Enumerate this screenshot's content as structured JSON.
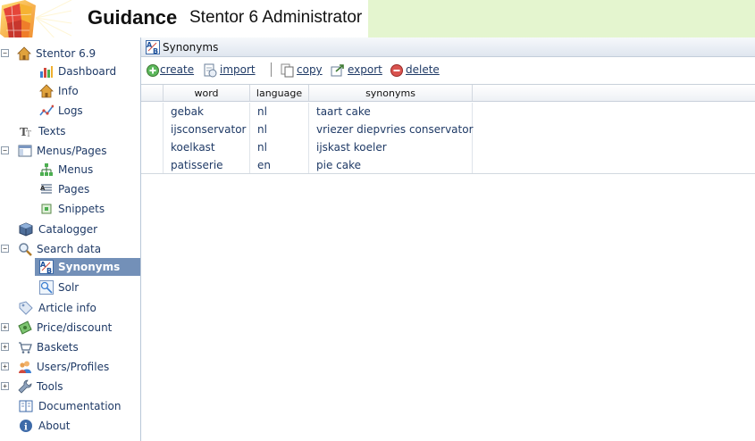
{
  "header": {
    "brand": "Guidance",
    "product": "Stentor 6 Administrator"
  },
  "sidebar": {
    "items": [
      {
        "label": "Stentor 6.9",
        "icon": "home-icon",
        "toggle": "−"
      },
      {
        "label": "Dashboard",
        "icon": "chart-icon"
      },
      {
        "label": "Info",
        "icon": "home-icon"
      },
      {
        "label": "Logs",
        "icon": "line-chart-icon"
      },
      {
        "label": "Texts",
        "icon": "text-icon"
      },
      {
        "label": "Menus/Pages",
        "icon": "layout-icon",
        "toggle": "−"
      },
      {
        "label": "Menus",
        "icon": "sitemap-icon"
      },
      {
        "label": "Pages",
        "icon": "page-icon"
      },
      {
        "label": "Snippets",
        "icon": "snippet-icon"
      },
      {
        "label": "Catalogger",
        "icon": "box-icon"
      },
      {
        "label": "Search data",
        "icon": "magnifier-icon",
        "toggle": "−"
      },
      {
        "label": "Synonyms",
        "icon": "synonyms-icon",
        "selected": true
      },
      {
        "label": "Solr",
        "icon": "solr-icon"
      },
      {
        "label": "Article info",
        "icon": "tag-icon"
      },
      {
        "label": "Price/discount",
        "icon": "money-icon",
        "toggle": "+"
      },
      {
        "label": "Baskets",
        "icon": "basket-icon",
        "toggle": "+"
      },
      {
        "label": "Users/Profiles",
        "icon": "users-icon",
        "toggle": "+"
      },
      {
        "label": "Tools",
        "icon": "wrench-icon",
        "toggle": "+"
      },
      {
        "label": "Documentation",
        "icon": "book-icon"
      },
      {
        "label": "About",
        "icon": "info-icon"
      }
    ]
  },
  "panel": {
    "title": "Synonyms"
  },
  "toolbar": {
    "create": "create",
    "import": "import",
    "copy": "copy",
    "export": "export",
    "delete": "delete"
  },
  "grid": {
    "columns": [
      "word",
      "language",
      "synonyms"
    ],
    "rows": [
      [
        "gebak",
        "nl",
        "taart cake"
      ],
      [
        "ijsconservator",
        "nl",
        "vriezer diepvries conservator"
      ],
      [
        "koelkast",
        "nl",
        "ijskast koeler"
      ],
      [
        "patisserie",
        "en",
        "pie cake"
      ]
    ]
  },
  "colors": {
    "selected": "#7390b8",
    "header_green": "#e4f5cf",
    "link": "#1f3a66"
  }
}
